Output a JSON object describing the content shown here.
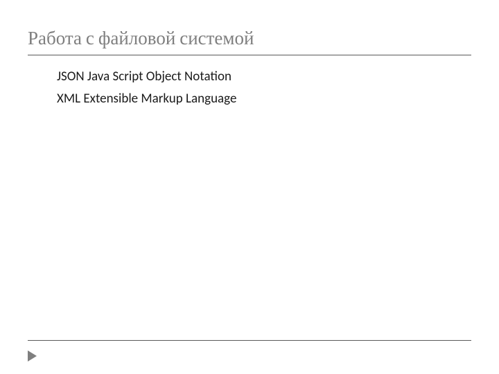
{
  "slide": {
    "title": "Работа с файловой системой",
    "bullets": [
      {
        "marker": "",
        "text": "JSON Java Script Object Notation"
      },
      {
        "marker": "",
        "text": "XML Extensible  Markup Language"
      }
    ]
  }
}
